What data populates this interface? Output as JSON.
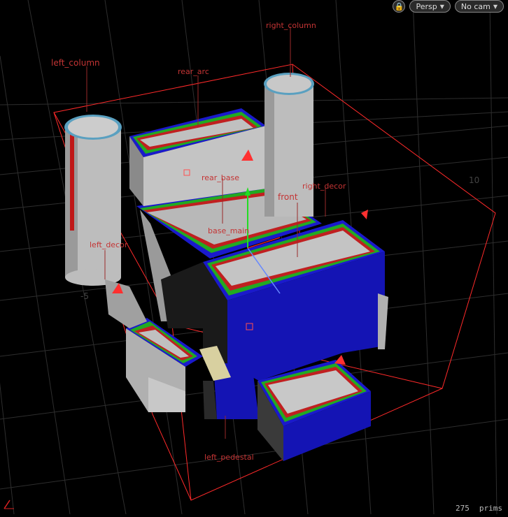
{
  "toolbar": {
    "lock_icon": "lock-icon",
    "camera_mode": "Persp",
    "camera_select": "No cam"
  },
  "scene_labels": {
    "left_column": "left_column",
    "rear_arc": "rear_arc",
    "right_column": "right_column",
    "rear_base": "rear_base",
    "front": "front",
    "right_decor": "right_decor",
    "base_main": "base_main",
    "left_decor": "left_decor",
    "left_pedestal": "left_pedestal"
  },
  "grid_numbers": {
    "left": "-5",
    "right": "10"
  },
  "status": {
    "count": "275",
    "unit": "prims"
  },
  "colors": {
    "bbox": "#ff2a2a",
    "blue_face": "#1414b4",
    "grey_face": "#b8b8b8",
    "grid": "#2a2a2a"
  }
}
